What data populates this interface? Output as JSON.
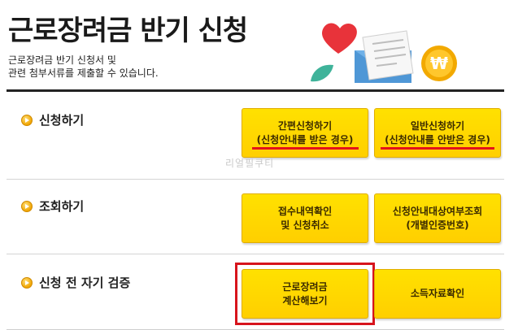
{
  "page": {
    "title": "근로장려금 반기 신청",
    "description_line1": "근로장려금 반기 신청서 및",
    "description_line2": "관련 첨부서류를 제출할 수 있습니다."
  },
  "watermark": "리얼필쿠티",
  "sections": {
    "apply": {
      "label": "신청하기",
      "simple_line1": "간편신청하기",
      "simple_line2": "(신청안내를 받은 경우)",
      "general_line1": "일반신청하기",
      "general_line2": "(신청안내를 안받은 경우)"
    },
    "inquiry": {
      "label": "조회하기",
      "receipt_line1": "접수내역확인",
      "receipt_line2": "및 신청취소",
      "target_line1": "신청안내대상여부조회",
      "target_line2": "(개별인증번호)"
    },
    "selfcheck": {
      "label": "신청 전 자기 검증",
      "calc_line1": "근로장려금",
      "calc_line2": "계산해보기",
      "income_label": "소득자료확인"
    }
  },
  "colors": {
    "button_yellow": "#ffd400",
    "accent_red": "#e4121a",
    "bullet_orange": "#f0a400"
  },
  "icons": [
    "heart-icon",
    "envelope-icon",
    "document-icon",
    "won-coin-icon",
    "leaf-icon"
  ]
}
